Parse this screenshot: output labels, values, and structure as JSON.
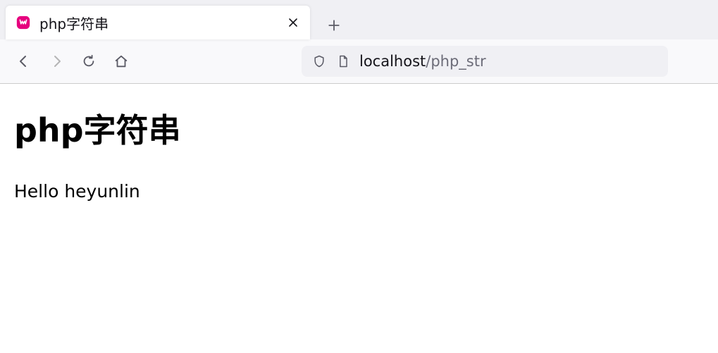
{
  "tab": {
    "title": "php字符串",
    "favicon_color": "#e6007e"
  },
  "url": {
    "host": "localhost",
    "path": "/php_str"
  },
  "page": {
    "heading": "php字符串",
    "body": "Hello heyunlin"
  }
}
